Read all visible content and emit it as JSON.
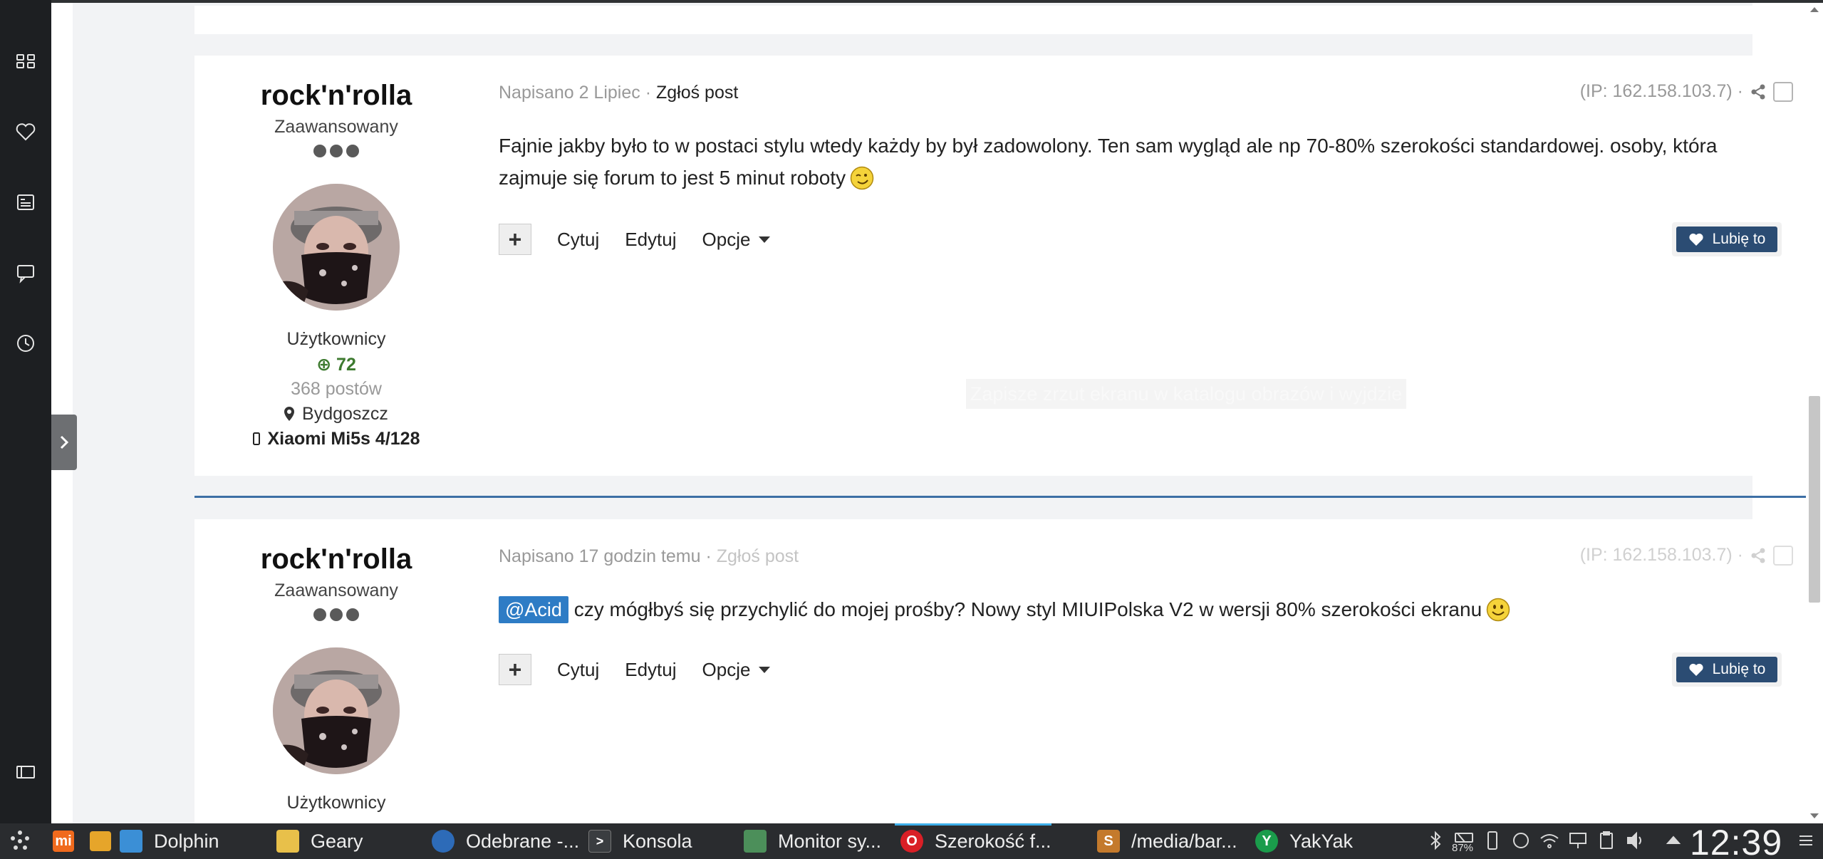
{
  "posts": [
    {
      "author": {
        "name": "rock'n'rolla",
        "rank": "Zaawansowany",
        "group": "Użytkownicy",
        "reputation": "72",
        "post_count": "368 postów",
        "location": "Bydgoszcz",
        "device": "Xiaomi Mi5s 4/128"
      },
      "posted": "Napisano 2 Lipiec",
      "separator": " · ",
      "report": "Zgłoś post",
      "ip": "(IP: 162.158.103.7) ·",
      "body": "Fajnie jakby było to w postaci stylu wtedy każdy by był zadowolony. Ten sam wygląd ale np 70-80% szerokości standardowej. osoby, która zajmuje się forum to jest 5 minut roboty",
      "emoji": "wink-emoji",
      "quote": "Cytuj",
      "edit": "Edytuj",
      "options": "Opcje",
      "like": "Lubię to"
    },
    {
      "author": {
        "name": "rock'n'rolla",
        "rank": "Zaawansowany",
        "group": "Użytkownicy"
      },
      "posted": "Napisano 17 godzin temu",
      "separator": " · ",
      "report": "Zgłoś post",
      "ip": "(IP: 162.158.103.7) ·",
      "mention": "@Acid",
      "body": "czy mógłbyś się przychylić do mojej prośby? Nowy styl MIUIPolska V2 w wersji 80% szerokości ekranu",
      "emoji": "smile-emoji",
      "quote": "Cytuj",
      "edit": "Edytuj",
      "options": "Opcje",
      "like": "Lubię to"
    }
  ],
  "toast": "Zapisze zrzut ekranu w katalogu obrazów i wyjdzie",
  "colors": {
    "accent": "#2b4c73",
    "separator": "#3d6fa5",
    "mention": "#2e7cc5",
    "reputation": "#3d7a2f"
  },
  "taskbar": {
    "items": [
      {
        "label": "Dolphin",
        "icon": "folder-icon"
      },
      {
        "label": "Geary",
        "icon": "mail-icon"
      },
      {
        "label": "Odebrane -...",
        "icon": "thunderbird-icon"
      },
      {
        "label": "Konsola",
        "icon": "terminal-icon"
      },
      {
        "label": "Monitor sy...",
        "icon": "system-monitor-icon"
      },
      {
        "label": "Szerokość f...",
        "icon": "opera-icon"
      },
      {
        "label": "/media/bar...",
        "icon": "sublime-icon"
      },
      {
        "label": "YakYak",
        "icon": "yakyak-icon"
      }
    ],
    "battery": "87%",
    "clock": "12:39"
  }
}
